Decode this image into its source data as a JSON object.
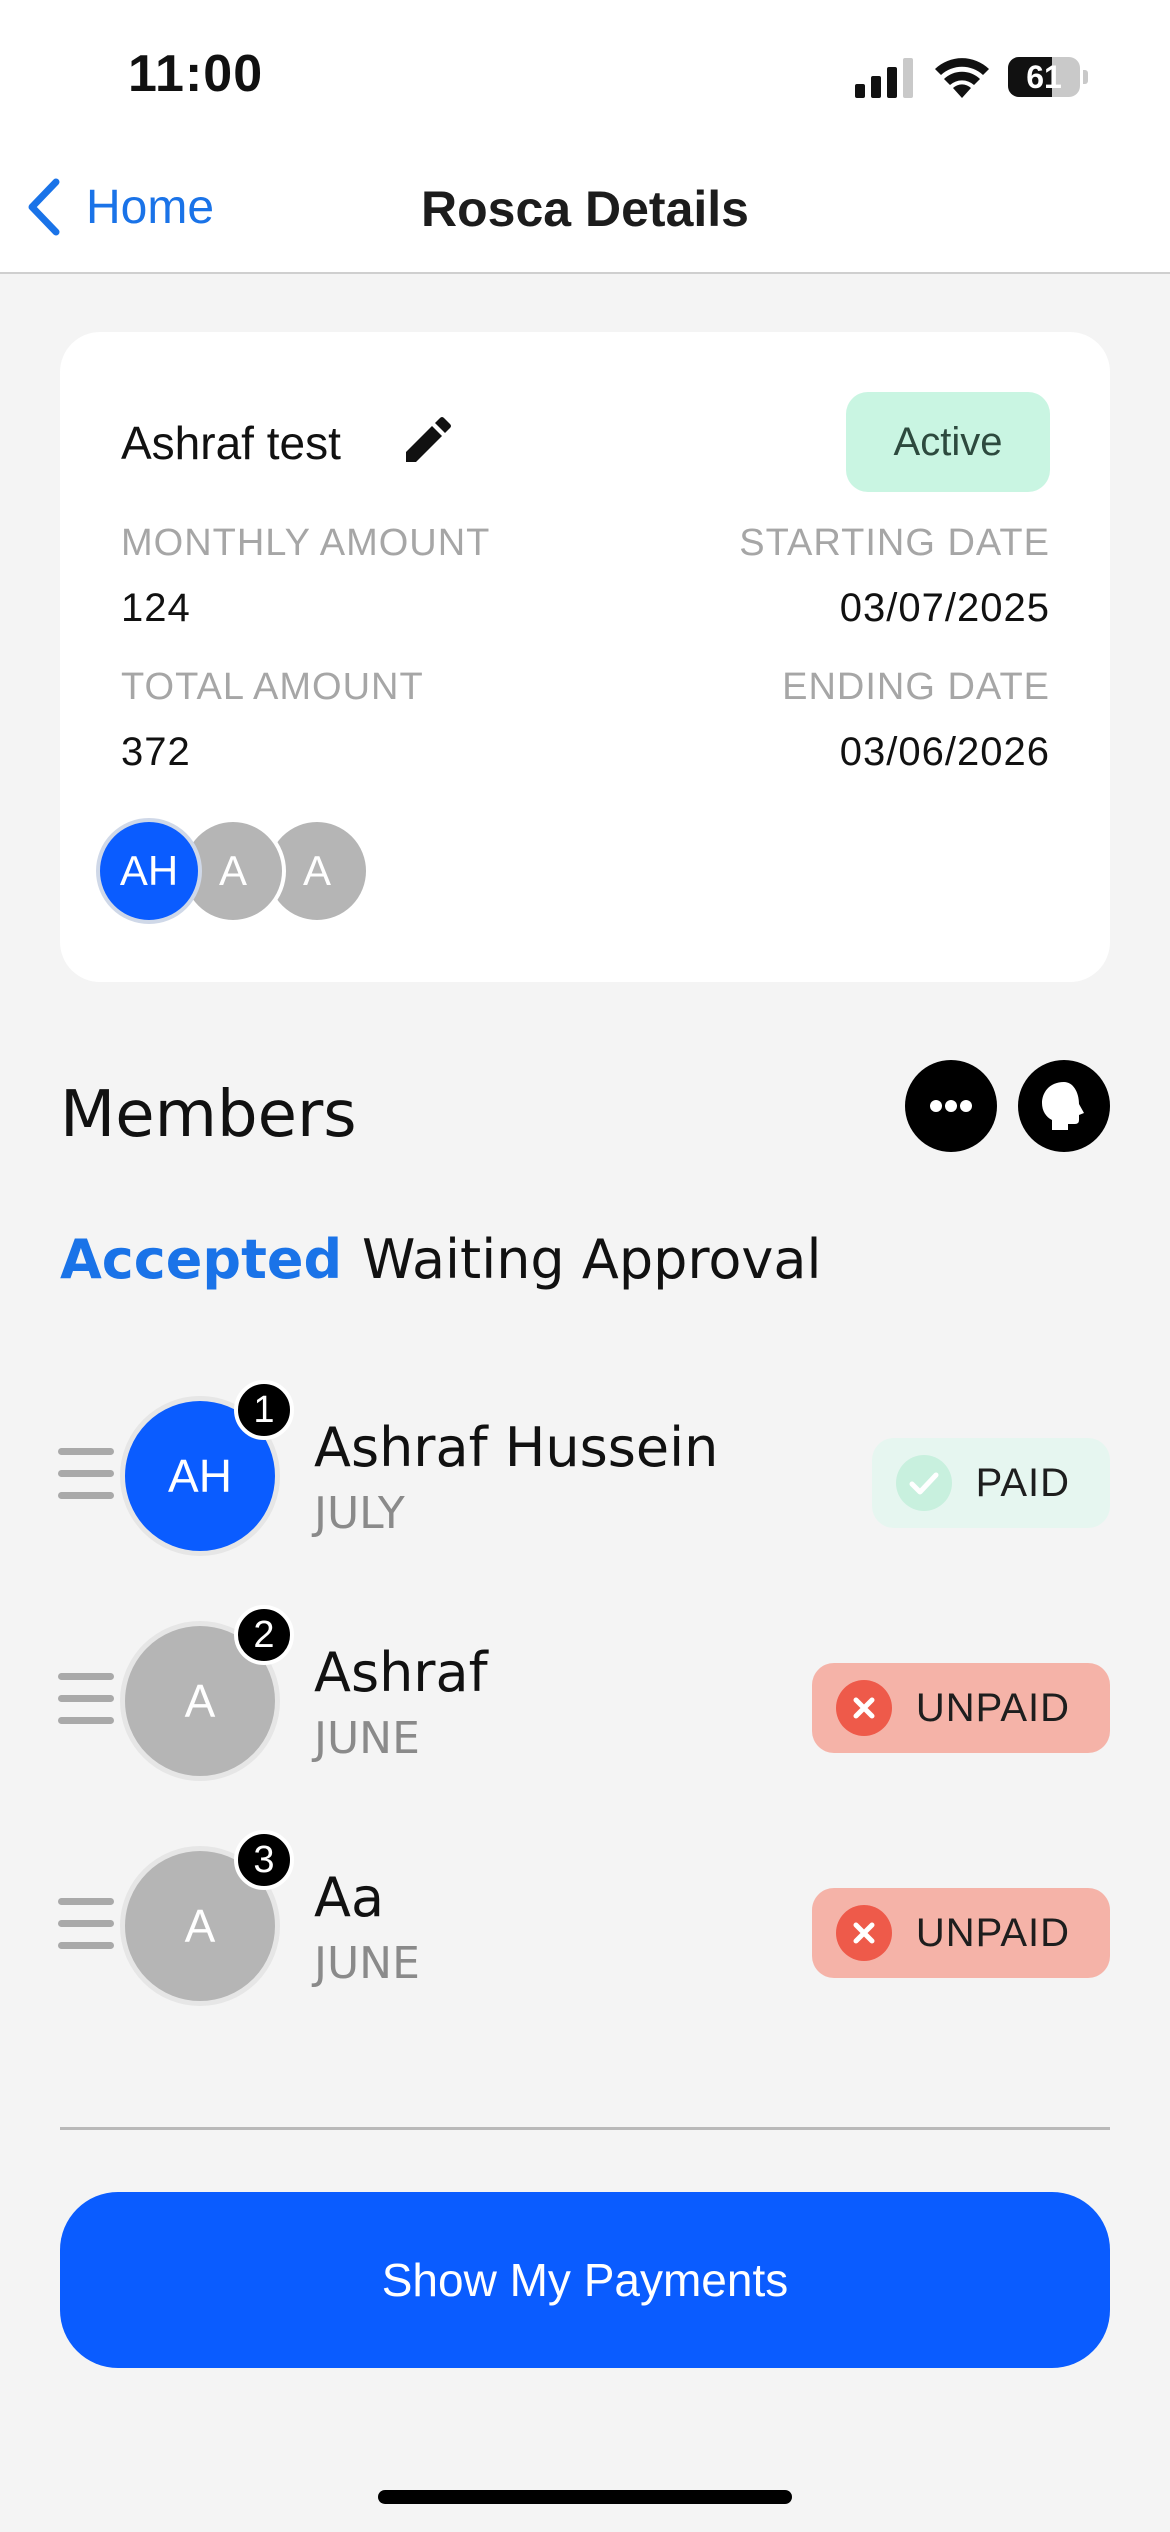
{
  "status_bar": {
    "time": "11:00",
    "battery": "61",
    "battery_level": 0.61
  },
  "nav": {
    "back_label": "Home",
    "title": "Rosca Details"
  },
  "rosca": {
    "name": "Ashraf test",
    "status": "Active",
    "monthly_amount_label": "MONTHLY AMOUNT",
    "monthly_amount": "124",
    "starting_date_label": "STARTING DATE",
    "starting_date": "03/07/2025",
    "total_amount_label": "TOTAL AMOUNT",
    "total_amount": "372",
    "ending_date_label": "ENDING DATE",
    "ending_date": "03/06/2026",
    "avatars": [
      {
        "initials": "AH",
        "color": "#0a5cff"
      },
      {
        "initials": "A",
        "color": "#b5b5b5"
      },
      {
        "initials": "A",
        "color": "#b5b5b5"
      }
    ]
  },
  "members": {
    "title": "Members",
    "tabs": [
      "Accepted",
      "Waiting Approval"
    ],
    "active_tab": "Accepted",
    "list": [
      {
        "order": "1",
        "initials": "AH",
        "name": "Ashraf Hussein",
        "month": "JULY",
        "status": "PAID",
        "avatar_color": "#0a5cff"
      },
      {
        "order": "2",
        "initials": "A",
        "name": "Ashraf",
        "month": "JUNE",
        "status": "UNPAID",
        "avatar_color": "#b5b5b5"
      },
      {
        "order": "3",
        "initials": "A",
        "name": "Aa",
        "month": "JUNE",
        "status": "UNPAID",
        "avatar_color": "#b5b5b5"
      }
    ]
  },
  "actions": {
    "show_payments_label": "Show My Payments"
  },
  "colors": {
    "accent": "#0a5cff",
    "link": "#1a73e8",
    "active_badge": "#c9f5e2",
    "unpaid": "#f5b3a8",
    "paid": "#e6f6f0"
  },
  "icons": {
    "back": "chevron-left-icon",
    "edit": "pencil-icon",
    "more": "more-horizontal-icon",
    "profile": "head-profile-icon",
    "paid": "check-circle-icon",
    "unpaid": "x-circle-icon",
    "drag": "drag-handle-icon"
  }
}
